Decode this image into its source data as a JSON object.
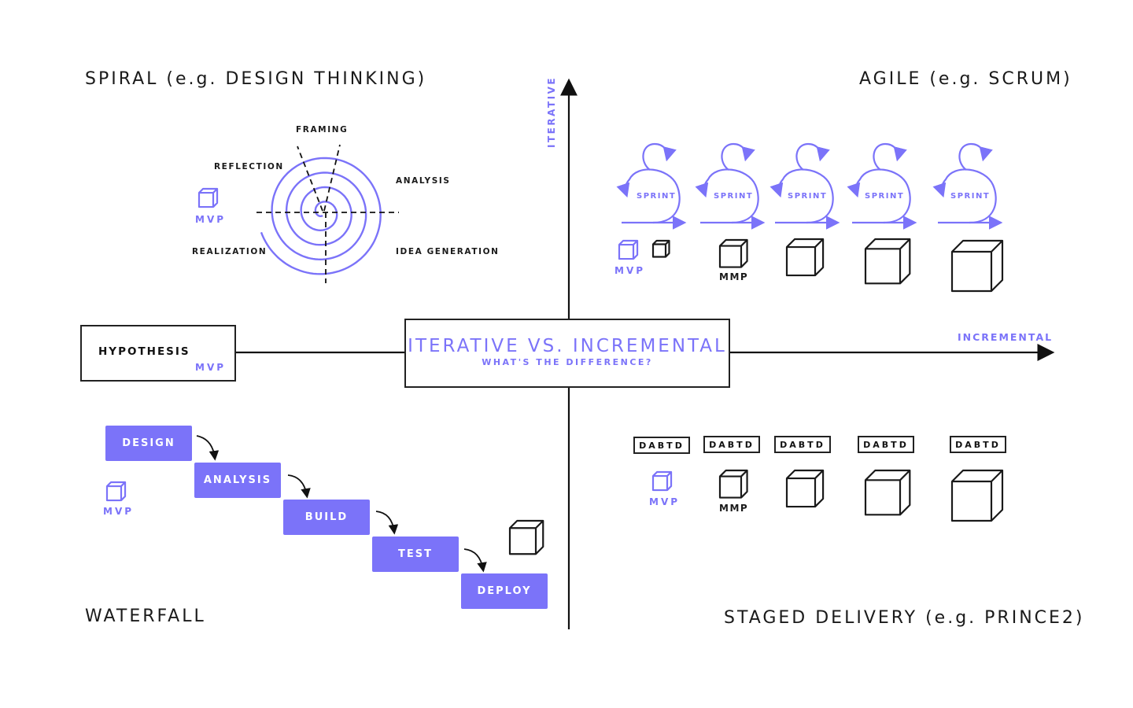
{
  "center": {
    "title": "ITERATIVE VS. INCREMENTAL",
    "subtitle": "WHAT'S THE DIFFERENCE?"
  },
  "axes": {
    "vertical_label": "ITERATIVE",
    "horizontal_label": "INCREMENTAL"
  },
  "hypothesis": {
    "label": "HYPOTHESIS",
    "mvp": "MVP"
  },
  "quadrants": {
    "spiral": {
      "title": "SPIRAL (e.g. DESIGN THINKING)",
      "phases": [
        "FRAMING",
        "REFLECTION",
        "ANALYSIS",
        "REALIZATION",
        "IDEA GENERATION"
      ],
      "mvp": "MVP"
    },
    "agile": {
      "title": "AGILE (e.g. SCRUM)",
      "sprints": [
        "SPRINT",
        "SPRINT",
        "SPRINT",
        "SPRINT",
        "SPRINT"
      ],
      "mvp": "MVP",
      "mmp": "MMP"
    },
    "waterfall": {
      "title": "WATERFALL",
      "steps": [
        "DESIGN",
        "ANALYSIS",
        "BUILD",
        "TEST",
        "DEPLOY"
      ],
      "mvp": "MVP"
    },
    "staged": {
      "title": "STAGED DELIVERY (e.g. PRINCE2)",
      "stages": [
        "DABTD",
        "DABTD",
        "DABTD",
        "DABTD",
        "DABTD"
      ],
      "mvp": "MVP",
      "mmp": "MMP"
    }
  },
  "colors": {
    "accent": "#7b73f9",
    "ink": "#1a1a1a",
    "background": "#ffffff"
  }
}
